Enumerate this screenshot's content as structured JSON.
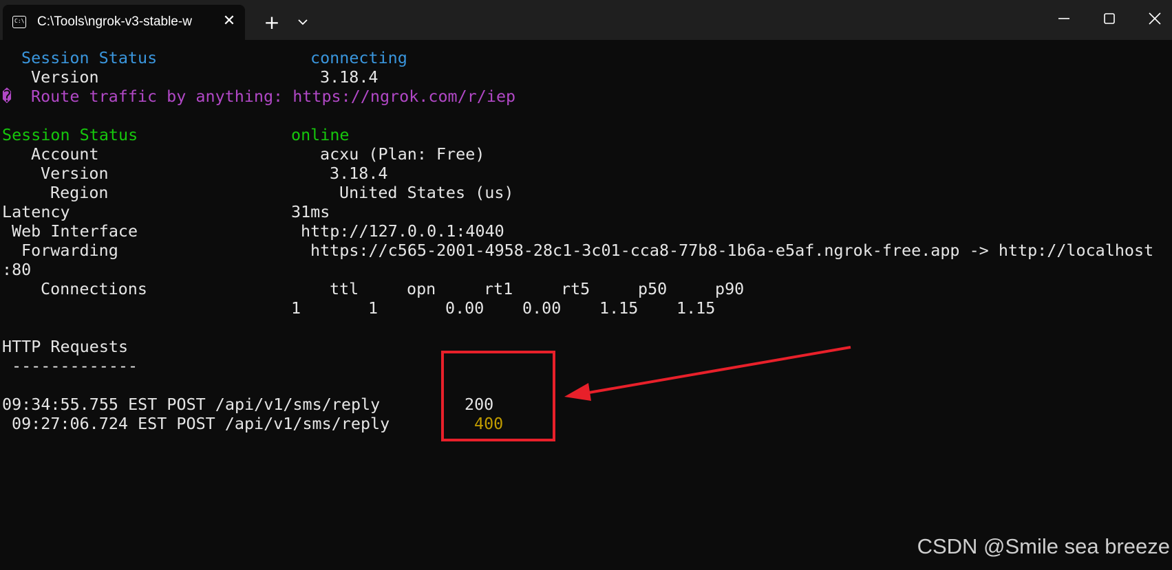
{
  "window": {
    "tab_title": "C:\\Tools\\ngrok-v3-stable-w",
    "tab_icon": "terminal-icon",
    "close_tab_symbol": "✕",
    "new_tab_symbol": "+",
    "icons": [
      "terminal-icon",
      "close-icon",
      "plus-icon",
      "chevron-down-icon",
      "minimize-icon",
      "maximize-icon",
      "close-window-icon"
    ]
  },
  "terminal": {
    "header_status_label": "Session Status",
    "header_status_value": "connecting",
    "header_version_label": "Version",
    "header_version_value": "3.18.4",
    "promo_symbol": "�",
    "promo_text": "Route traffic by anything: https://ngrok.com/r/iep",
    "session_status_label": "Session Status",
    "session_status_value": "online",
    "account_label": "Account",
    "account_value": "acxu (Plan: Free)",
    "version_label": "Version",
    "version_value": "3.18.4",
    "region_label": "Region",
    "region_value": "United States (us)",
    "latency_label": "Latency",
    "latency_value": "31ms",
    "web_interface_label": "Web Interface",
    "web_interface_value": "http://127.0.0.1:4040",
    "forwarding_label": "Forwarding",
    "forwarding_value": "https://c565-2001-4958-28c1-3c01-cca8-77b8-1b6a-e5af.ngrok-free.app -> http://localhost",
    "forwarding_wrap": ":80",
    "connections_label": "Connections",
    "connections_headers": [
      "ttl",
      "opn",
      "rt1",
      "rt5",
      "p50",
      "p90"
    ],
    "connections_values": [
      "1",
      "1",
      "0.00",
      "0.00",
      "1.15",
      "1.15"
    ],
    "http_requests_title": "HTTP Requests",
    "http_requests_rule": "-------------",
    "requests": [
      {
        "entry": "09:34:55.755 EST POST /api/v1/sms/reply",
        "status": "200"
      },
      {
        "entry": "09:27:06.724 EST POST /api/v1/sms/reply",
        "status": "400"
      }
    ]
  },
  "colors": {
    "background": "#0c0c0c",
    "titlebar": "#1f1f1f",
    "blue": "#3a96dd",
    "purple": "#b148c6",
    "green": "#16c60c",
    "yellow": "#c19c00",
    "annotation_red": "#e8202a"
  },
  "watermark": "CSDN @Smile sea breeze"
}
